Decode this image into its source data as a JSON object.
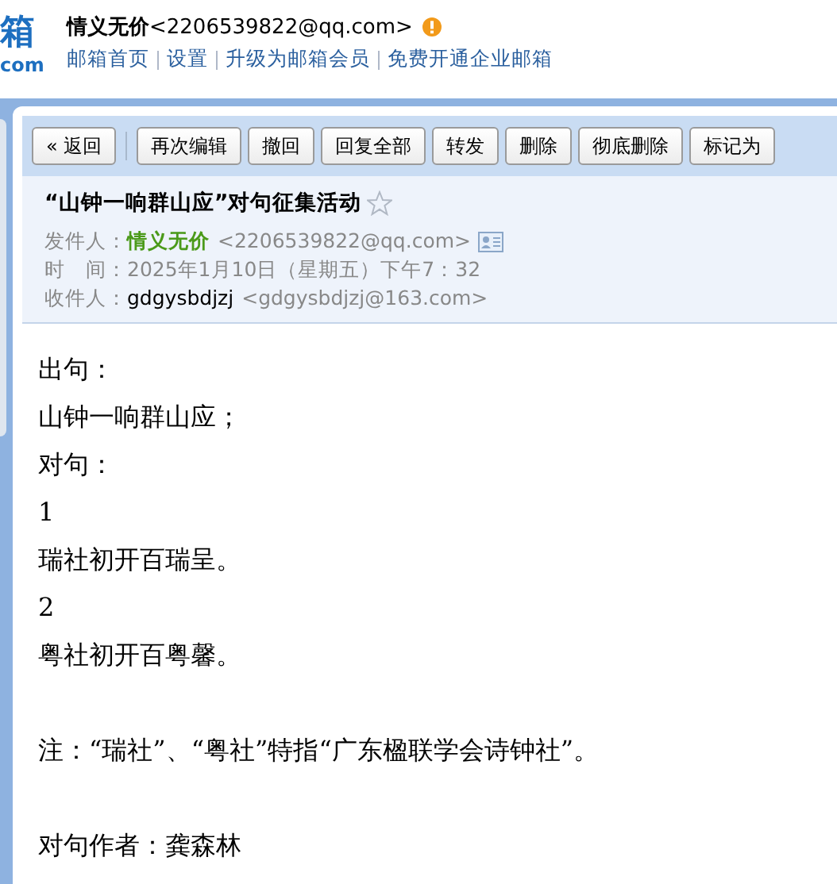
{
  "header": {
    "logo_text": "箱",
    "logo_domain": "com",
    "account_name": "情义无价",
    "account_email": "<2206539822@qq.com>",
    "links": [
      "邮箱首页",
      "设置",
      "升级为邮箱会员",
      "免费开通企业邮箱"
    ]
  },
  "toolbar": {
    "buttons": [
      {
        "label": "« 返回"
      },
      {
        "label": "再次编辑"
      },
      {
        "label": "撤回"
      },
      {
        "label": "回复全部"
      },
      {
        "label": "转发"
      },
      {
        "label": "删除"
      },
      {
        "label": "彻底删除"
      },
      {
        "label": "标记为"
      }
    ]
  },
  "message": {
    "subject": "“山钟一响群山应”对句征集活动",
    "starred": false,
    "fields": [
      {
        "label": "发件人：",
        "name": "情义无价",
        "address": "<2206539822@qq.com>",
        "kind": "sender"
      },
      {
        "label": "时　间：",
        "name": "2025年1月10日（星期五）下午7：32",
        "kind": "time"
      },
      {
        "label": "收件人：",
        "name": "gdgysbdjzj",
        "address": "<gdgysbdjzj@163.com>",
        "kind": "recipient"
      }
    ]
  },
  "body": [
    [
      "出句：",
      "山钟一响群山应；",
      "对句：",
      "1",
      "瑞社初开百瑞呈。",
      "2",
      "粤社初开百粤馨。"
    ],
    [
      "注：“瑞社”、“粤社”特指“广东楹联学会诗钟社”。"
    ],
    [
      "对句作者：龚森林"
    ]
  ]
}
